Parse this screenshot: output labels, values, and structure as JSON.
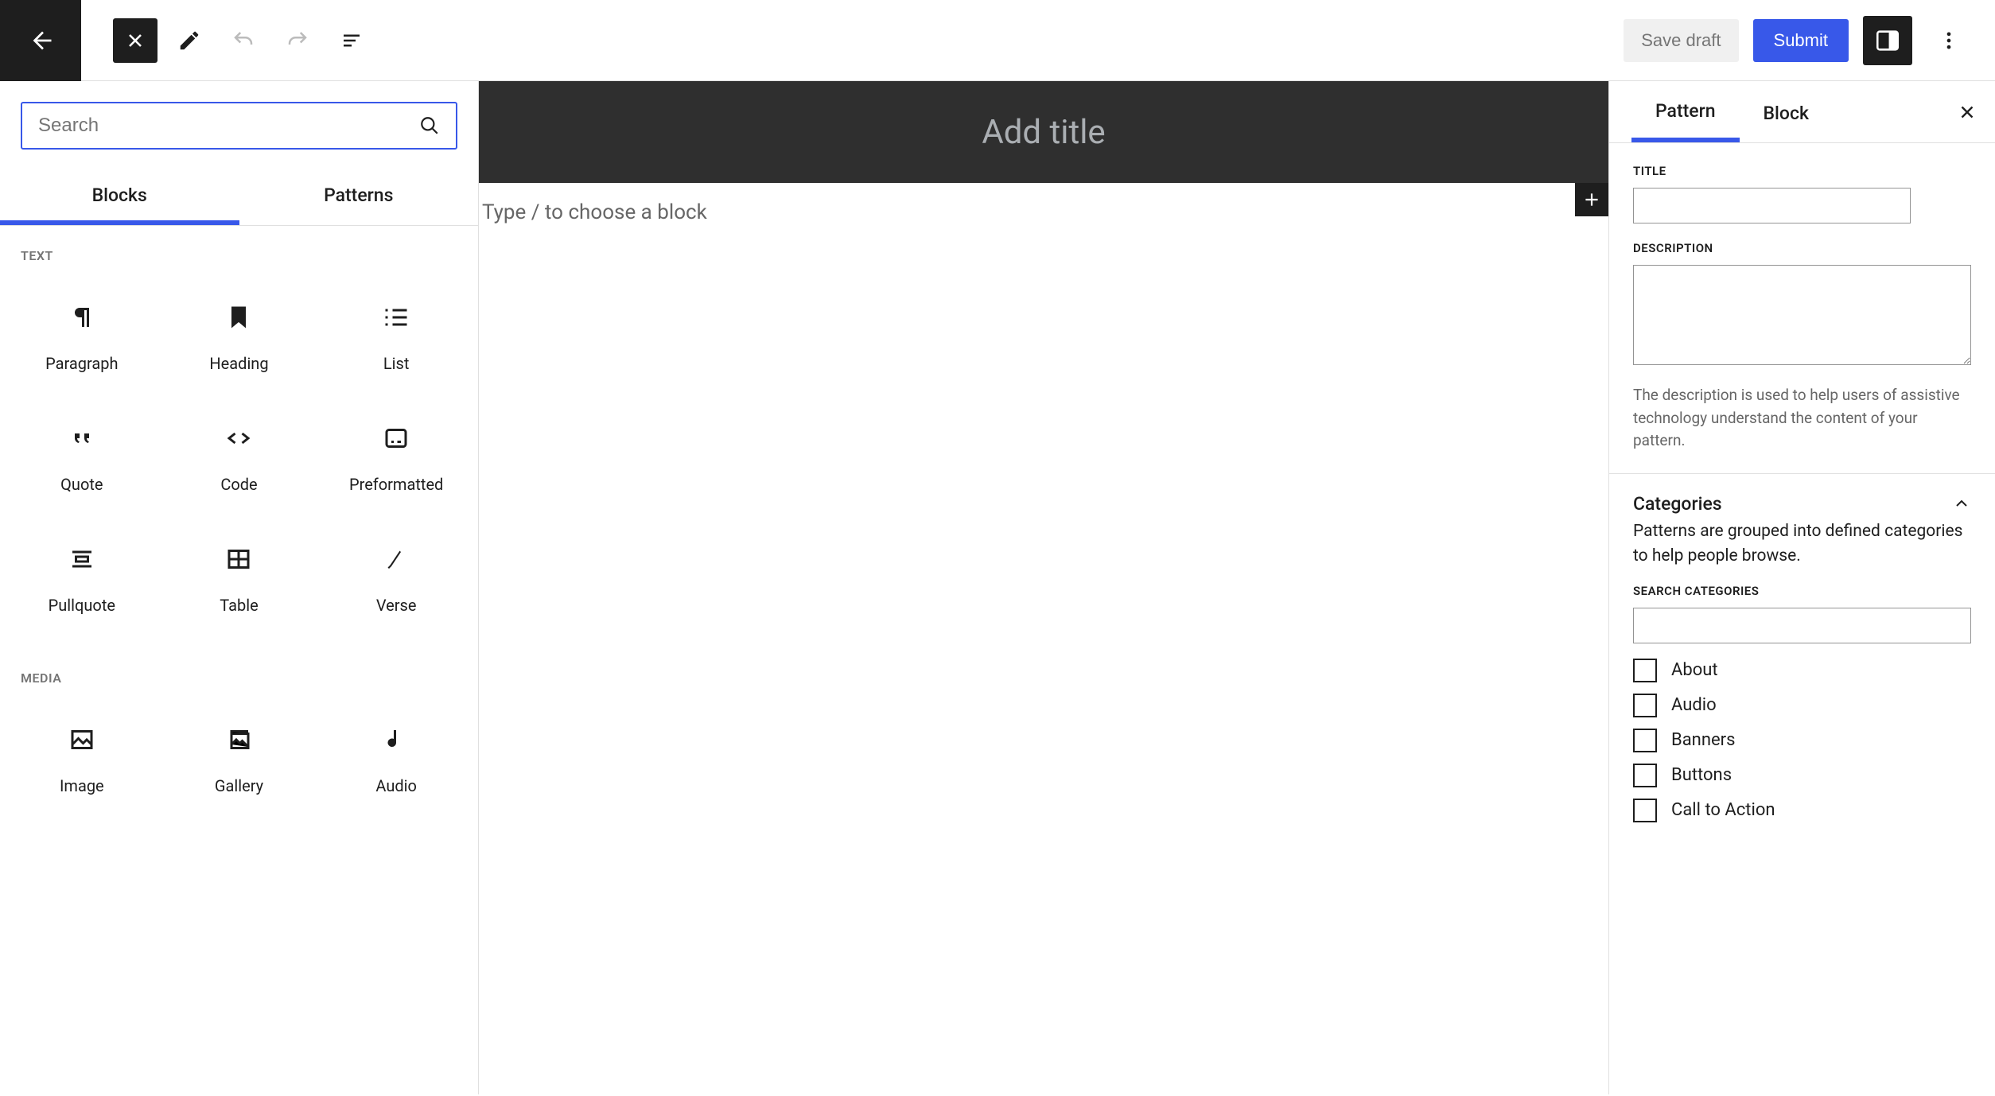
{
  "toolbar": {
    "save_draft": "Save draft",
    "submit": "Submit"
  },
  "inserter": {
    "search_placeholder": "Search",
    "tabs": {
      "blocks": "Blocks",
      "patterns": "Patterns"
    },
    "sections": {
      "text": "TEXT",
      "media": "MEDIA"
    },
    "blocks_text": [
      {
        "label": "Paragraph"
      },
      {
        "label": "Heading"
      },
      {
        "label": "List"
      },
      {
        "label": "Quote"
      },
      {
        "label": "Code"
      },
      {
        "label": "Preformatted"
      },
      {
        "label": "Pullquote"
      },
      {
        "label": "Table"
      },
      {
        "label": "Verse"
      }
    ],
    "blocks_media": [
      {
        "label": "Image"
      },
      {
        "label": "Gallery"
      },
      {
        "label": "Audio"
      }
    ]
  },
  "canvas": {
    "title_placeholder": "Add title",
    "body_placeholder": "Type / to choose a block"
  },
  "sidebar": {
    "tabs": {
      "pattern": "Pattern",
      "block": "Block"
    },
    "title_label": "TITLE",
    "description_label": "DESCRIPTION",
    "description_help": "The description is used to help users of assistive technology understand the content of your pattern.",
    "categories_heading": "Categories",
    "categories_desc": "Patterns are grouped into defined categories to help people browse.",
    "search_categories_label": "SEARCH CATEGORIES",
    "categories": [
      "About",
      "Audio",
      "Banners",
      "Buttons",
      "Call to Action"
    ]
  }
}
